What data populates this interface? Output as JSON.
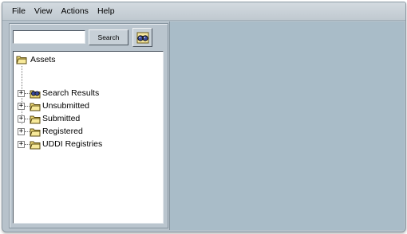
{
  "menu": {
    "file": "File",
    "view": "View",
    "actions": "Actions",
    "help": "Help"
  },
  "search": {
    "value": "",
    "button_label": "Search",
    "binoculars_icon": "binoculars-icon"
  },
  "tree": {
    "root": {
      "label": "Assets",
      "icon": "folder-open-icon"
    },
    "items": [
      {
        "label": "Search Results",
        "icon": "search-results-icon",
        "expander": "+"
      },
      {
        "label": "Unsubmitted",
        "icon": "folder-icon",
        "expander": "+"
      },
      {
        "label": "Submitted",
        "icon": "folder-icon",
        "expander": "+"
      },
      {
        "label": "Registered",
        "icon": "folder-icon",
        "expander": "+"
      },
      {
        "label": "UDDI Registries",
        "icon": "folder-icon",
        "expander": "+"
      }
    ]
  },
  "colors": {
    "window_bg": "#b7c2cb",
    "detail_pane_bg": "#a9bcc8",
    "folder_yellow": "#f0dc78"
  }
}
